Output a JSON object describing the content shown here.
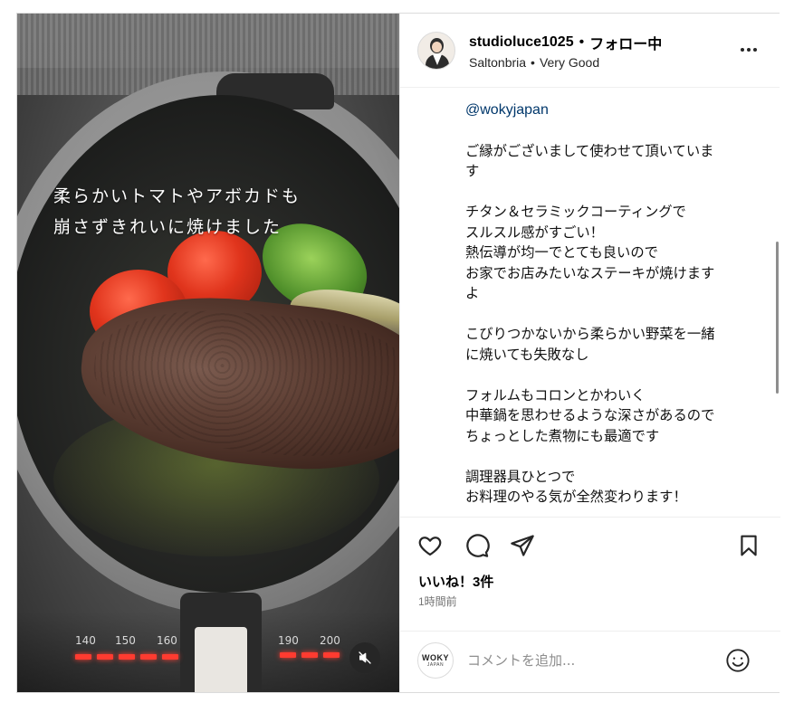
{
  "media": {
    "overlay_lines": [
      "柔らかいトマトやアボカドも",
      "崩さずきれいに焼けました"
    ],
    "heat_labels": [
      "140",
      "150",
      "160",
      "190",
      "200"
    ],
    "mute_icon": "speaker-muted-icon"
  },
  "header": {
    "username": "studioluce1025",
    "separator": "•",
    "follow_status": "フォロー中",
    "location_name": "Saltonbria",
    "location_separator": "•",
    "location_rating": "Very Good",
    "more_icon": "more-options-icon"
  },
  "caption": {
    "mention": "@wokyjapan",
    "paragraphs": [
      [
        "ご縁がございまして使わせて頂いていま",
        "す"
      ],
      [
        "チタン＆セラミックコーティングで",
        "スルスル感がすごい！",
        "熱伝導が均一でとても良いので",
        "お家でお店みたいなステーキが焼けます",
        "よ"
      ],
      [
        "こびりつかないから柔らかい野菜を一緒",
        "に焼いても失敗なし"
      ],
      [
        "フォルムもコロンとかわいく",
        "中華鍋を思わせるような深さがあるので",
        "ちょっとした煮物にも最適です"
      ],
      [
        "調理器具ひとつで",
        "お料理のやる気が全然変わります！"
      ]
    ]
  },
  "actions": {
    "icons": [
      "heart-icon",
      "comment-icon",
      "share-icon",
      "bookmark-icon"
    ],
    "likes": "いいね！3件",
    "time": "1時間前"
  },
  "comment": {
    "avatar_logo_main": "WOKY",
    "avatar_logo_sub": "JAPAN",
    "placeholder": "コメントを追加...",
    "emoji_icon": "emoji-icon"
  },
  "colors": {
    "link": "#00376b",
    "border": "#dbdbdb",
    "secondary_text": "#737373"
  }
}
